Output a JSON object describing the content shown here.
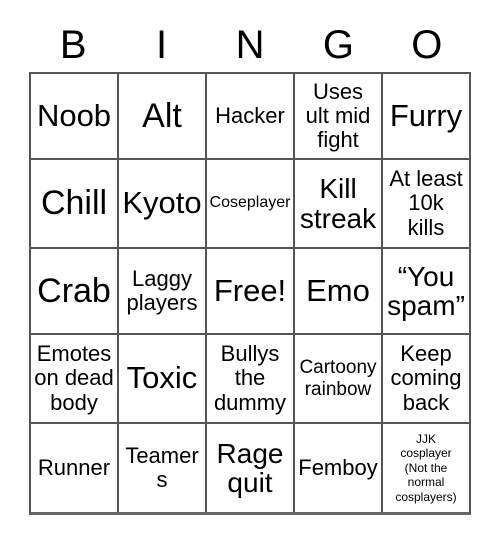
{
  "card": {
    "title": "BINGO Card",
    "background_color": "#ffffff",
    "border_color": "#555555",
    "text_color": "#000000",
    "headers": [
      "B",
      "I",
      "N",
      "G",
      "O"
    ],
    "rows": [
      [
        {
          "text": "Noob",
          "size": "xl"
        },
        {
          "text": "Alt",
          "size": "xxl"
        },
        {
          "text": "Hacker",
          "size": "md"
        },
        {
          "text": "Uses\nult mid\nfight",
          "size": "md"
        },
        {
          "text": "Furry",
          "size": "xl"
        }
      ],
      [
        {
          "text": "Chill",
          "size": "xxl"
        },
        {
          "text": "Kyoto",
          "size": "xl"
        },
        {
          "text": "Coseplayer",
          "size": "xs"
        },
        {
          "text": "Kill\nstreak",
          "size": "lg"
        },
        {
          "text": "At least\n10k\nkills",
          "size": "md"
        }
      ],
      [
        {
          "text": "Crab",
          "size": "xxl"
        },
        {
          "text": "Laggy\nplayers",
          "size": "md"
        },
        {
          "text": "Free!",
          "size": "xl"
        },
        {
          "text": "Emo",
          "size": "xl"
        },
        {
          "text": "“You\nspam”",
          "size": "lg"
        }
      ],
      [
        {
          "text": "Emotes\non dead\nbody",
          "size": "md"
        },
        {
          "text": "Toxic",
          "size": "xl"
        },
        {
          "text": "Bullys\nthe\ndummy",
          "size": "md"
        },
        {
          "text": "Cartoony\nrainbow",
          "size": "sm"
        },
        {
          "text": "Keep\ncoming\nback",
          "size": "md"
        }
      ],
      [
        {
          "text": "Runner",
          "size": "md"
        },
        {
          "text": "Teamers",
          "size": "md"
        },
        {
          "text": "Rage\nquit",
          "size": "lg"
        },
        {
          "text": "Femboy",
          "size": "md"
        },
        {
          "text": "JJK\ncosplayer\n(Not the\nnormal\ncosplayers)",
          "size": "xxs"
        }
      ]
    ]
  }
}
